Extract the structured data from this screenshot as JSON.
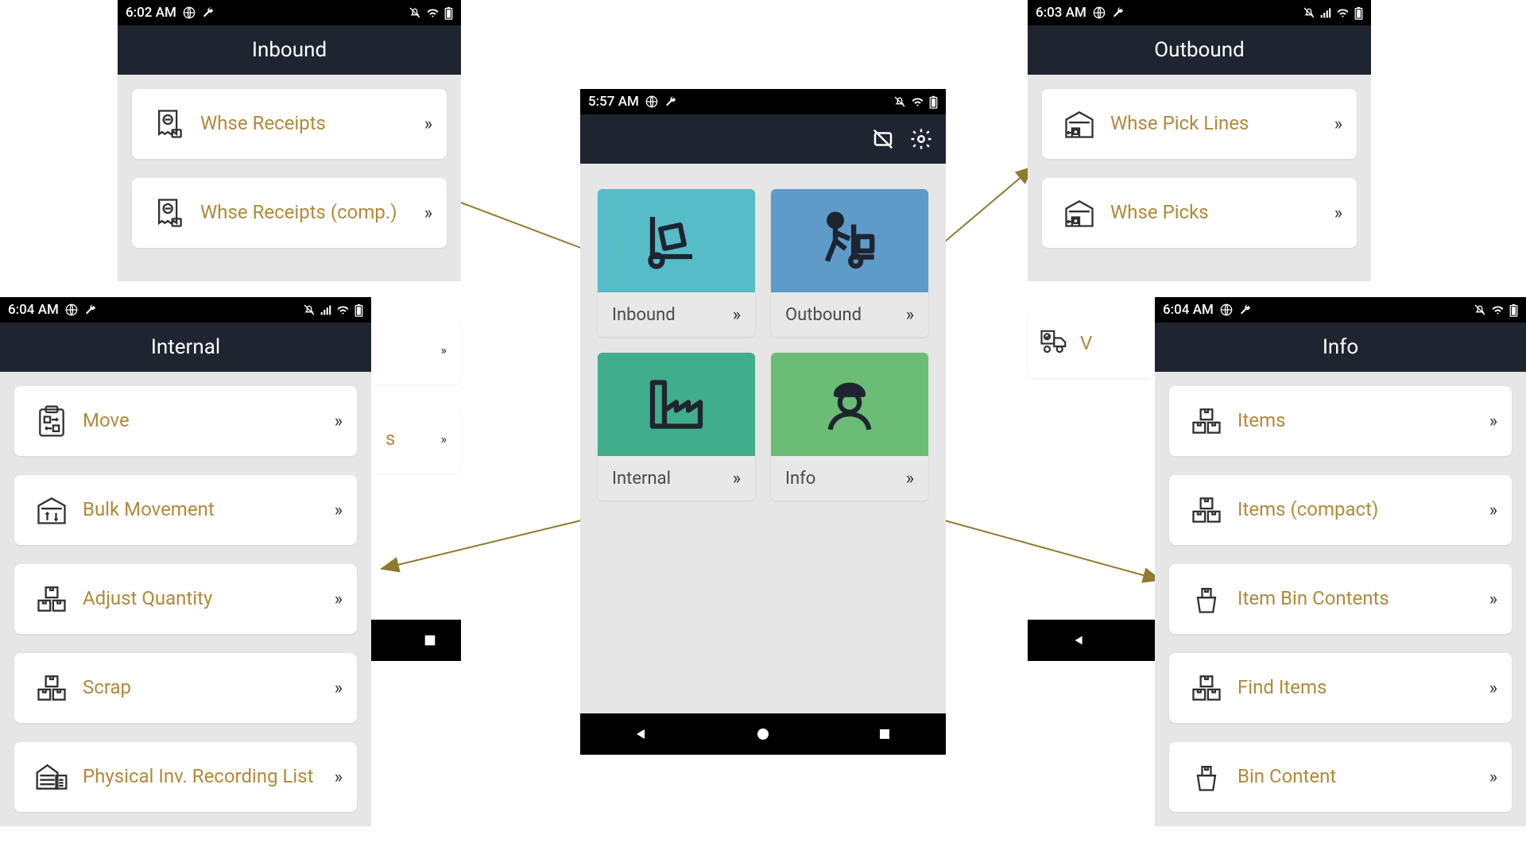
{
  "colors": {
    "accent_text": "#b2893a",
    "tile_inbound": "#56bcc8",
    "tile_outbound": "#5f9bc9",
    "tile_internal": "#40ad8b",
    "tile_info": "#6bbd75",
    "header_bg": "#1e2530"
  },
  "inbound": {
    "time": "6:02 AM",
    "title": "Inbound",
    "items": [
      {
        "label": "Whse Receipts",
        "icon": "receipt-minus-icon"
      },
      {
        "label": "Whse Receipts (comp.)",
        "icon": "receipt-minus-icon"
      }
    ],
    "hidden_item_suffix": "s"
  },
  "outbound": {
    "time": "6:03 AM",
    "title": "Outbound",
    "items": [
      {
        "label": "Whse Pick Lines",
        "icon": "warehouse-out-icon"
      },
      {
        "label": "Whse Picks",
        "icon": "warehouse-out-icon"
      }
    ],
    "hidden_item_prefix": "V"
  },
  "internal": {
    "time": "6:04 AM",
    "title": "Internal",
    "items": [
      {
        "label": "Move",
        "icon": "clipboard-move-icon"
      },
      {
        "label": "Bulk Movement",
        "icon": "warehouse-updown-icon"
      },
      {
        "label": "Adjust Quantity",
        "icon": "boxes-icon"
      },
      {
        "label": "Scrap",
        "icon": "boxes-icon"
      },
      {
        "label": "Physical Inv. Recording List",
        "icon": "warehouse-list-icon"
      }
    ]
  },
  "info": {
    "time": "6:04 AM",
    "title": "Info",
    "items": [
      {
        "label": "Items",
        "icon": "boxes-icon"
      },
      {
        "label": "Items (compact)",
        "icon": "boxes-icon"
      },
      {
        "label": "Item Bin Contents",
        "icon": "bin-icon"
      },
      {
        "label": "Find Items",
        "icon": "boxes-icon"
      },
      {
        "label": "Bin Content",
        "icon": "bin-icon"
      }
    ]
  },
  "center": {
    "time": "5:57 AM",
    "tiles": [
      {
        "label": "Inbound",
        "icon": "dolly-icon",
        "color": "#56bcc8"
      },
      {
        "label": "Outbound",
        "icon": "worker-dolly-icon",
        "color": "#5f9bc9"
      },
      {
        "label": "Internal",
        "icon": "factory-icon",
        "color": "#40ad8b"
      },
      {
        "label": "Info",
        "icon": "worker-hardhat-icon",
        "color": "#6bbd75"
      }
    ]
  }
}
